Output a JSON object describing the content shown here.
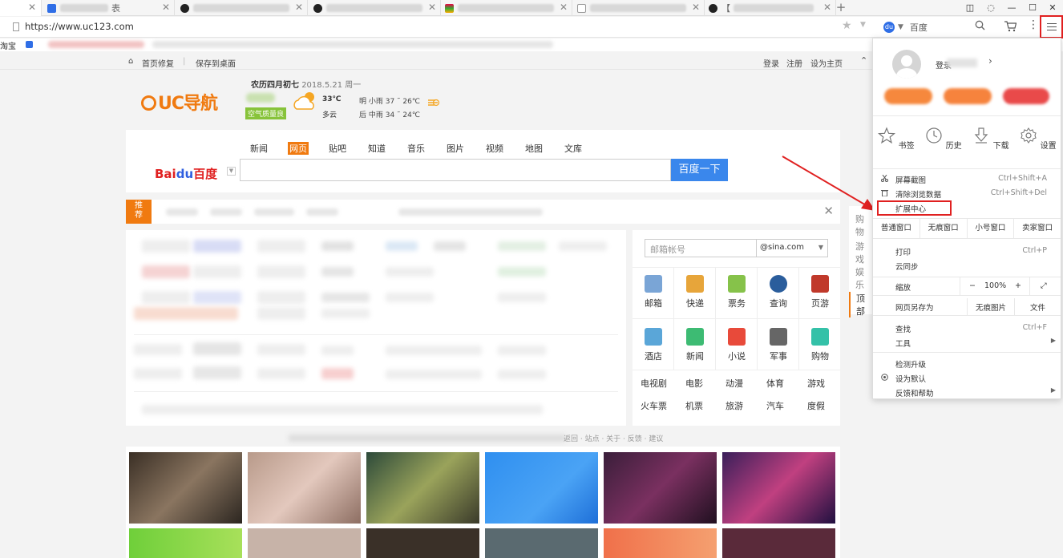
{
  "tabs": [
    {
      "title": "",
      "active": true
    },
    {
      "title": "表",
      "active": false
    },
    {
      "title": "",
      "active": false
    },
    {
      "title": "",
      "active": false
    },
    {
      "title": "",
      "active": false
    },
    {
      "title": "",
      "active": false
    },
    {
      "title": "【",
      "active": false
    }
  ],
  "address": {
    "url": "https://www.uc123.com"
  },
  "search_engine": {
    "label": "百度"
  },
  "bookmarks": {
    "first": "淘宝"
  },
  "topbar": {
    "home": "首页修复",
    "save_desktop": "保存到桌面",
    "login": "登录",
    "register": "注册",
    "set_home": "设为主页"
  },
  "logo": {
    "text": "UC导航"
  },
  "weather": {
    "lunar": "农历四月初七",
    "date": "2018.5.21 周一",
    "air": "空气质量良",
    "temp": "33℃",
    "condition": "多云",
    "tomorrow": "明  小雨  37 ˜ 26℃",
    "after": "后  中雨  34 ˜ 24℃"
  },
  "search": {
    "tabs": [
      "新闻",
      "网页",
      "贴吧",
      "知道",
      "音乐",
      "图片",
      "视频",
      "地图",
      "文库"
    ],
    "active_tab": "网页",
    "button": "百度一下",
    "logo_a": "Bai",
    "logo_b": "du",
    "logo_c": "百度"
  },
  "recommend": {
    "tag_line1": "推",
    "tag_line2": "荐",
    "close": "✕"
  },
  "mail": {
    "placeholder": "邮箱帐号",
    "domain": "@sina.com"
  },
  "services_row1": [
    {
      "label": "邮箱",
      "color": "#7aa5d6"
    },
    {
      "label": "快递",
      "color": "#e7a53a"
    },
    {
      "label": "票务",
      "color": "#86c24a"
    },
    {
      "label": "查询",
      "color": "#2a5d9c"
    },
    {
      "label": "页游",
      "color": "#c0392b"
    }
  ],
  "services_row2": [
    {
      "label": "酒店",
      "color": "#5aa6d8"
    },
    {
      "label": "新闻",
      "color": "#3dbb73"
    },
    {
      "label": "小说",
      "color": "#e84a3a"
    },
    {
      "label": "军事",
      "color": "#666666"
    },
    {
      "label": "购物",
      "color": "#34c1a8"
    }
  ],
  "text_links": [
    [
      "电视剧",
      "电影",
      "动漫",
      "体育",
      "游戏"
    ],
    [
      "火车票",
      "机票",
      "旅游",
      "汽车",
      "度假"
    ]
  ],
  "side": {
    "shopping": "购物",
    "games": "游戏",
    "fun": "娱乐",
    "top": "顶部"
  },
  "footer_text": "返回 · 站点 · 关于 · 反馈 · 建议",
  "menu": {
    "login": "登录",
    "login_arrow": "›",
    "icons4": [
      {
        "label": "书签",
        "icon": "star-icon"
      },
      {
        "label": "历史",
        "icon": "clock-icon"
      },
      {
        "label": "下载",
        "icon": "download-icon"
      },
      {
        "label": "设置",
        "icon": "gear-icon"
      }
    ],
    "screenshot": "屏幕截图",
    "screenshot_sc": "Ctrl+Shift+A",
    "clear": "清除浏览数据",
    "clear_sc": "Ctrl+Shift+Del",
    "extensions": "扩展中心",
    "windows": [
      "普通窗口",
      "无痕窗口",
      "小号窗口",
      "卖家窗口"
    ],
    "print": "打印",
    "print_sc": "Ctrl+P",
    "sync": "云同步",
    "zoom": "缩放",
    "zoom_minus": "−",
    "zoom_value": "100%",
    "zoom_plus": "+",
    "fullscreen": "⤢",
    "save_as": "网页另存为",
    "no_images": "无痕图片",
    "file": "文件",
    "find": "查找",
    "find_sc": "Ctrl+F",
    "tools": "工具",
    "update": "检测升级",
    "set_default": "设为默认",
    "feedback": "反馈和帮助"
  }
}
